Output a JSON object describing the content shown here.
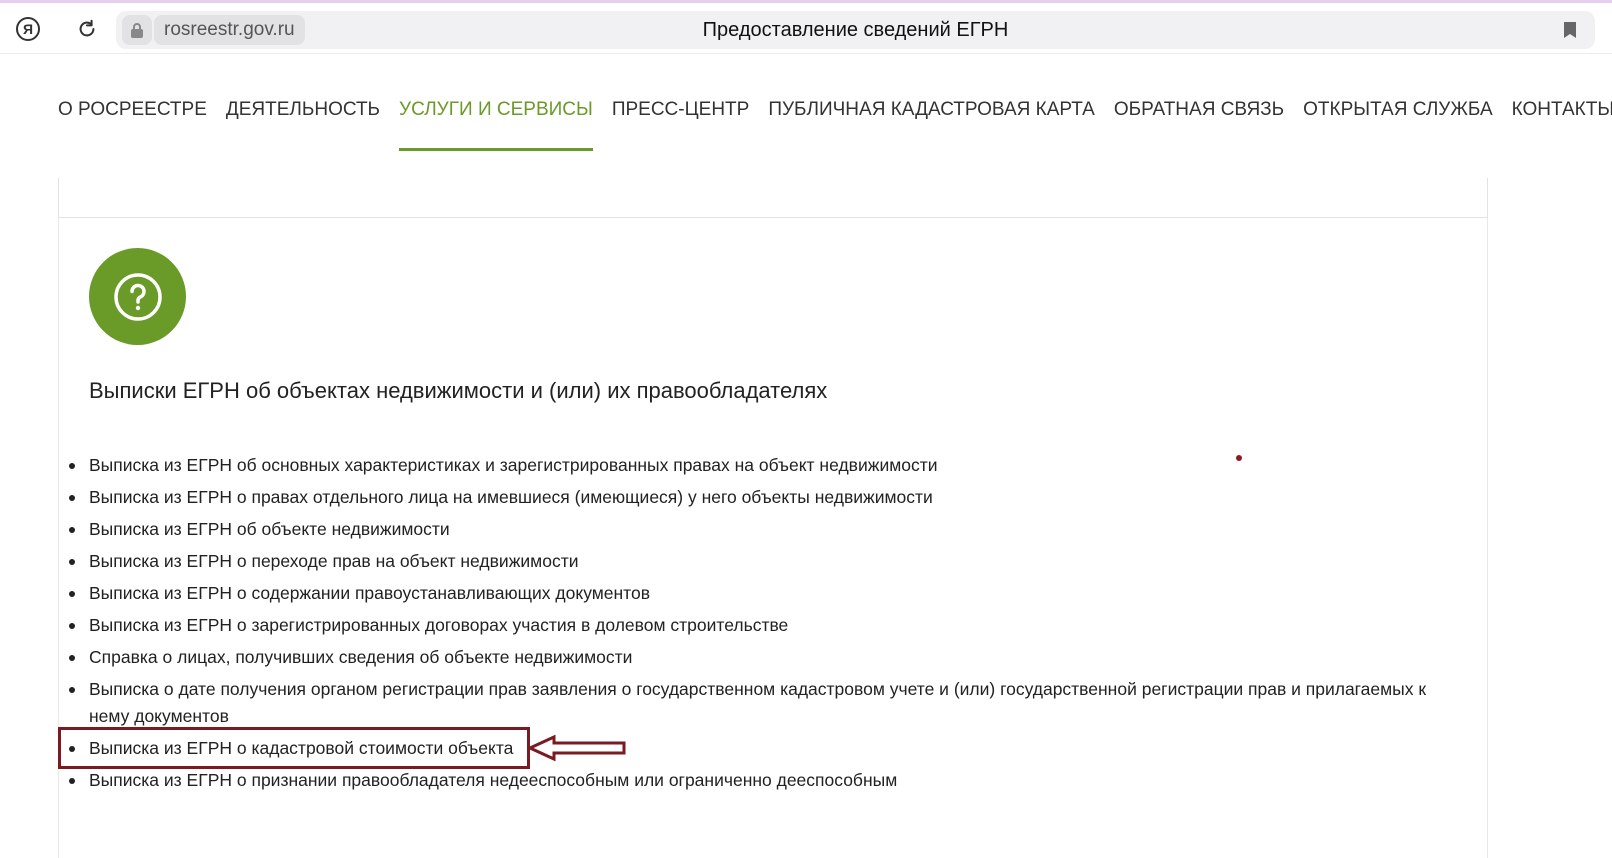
{
  "browser": {
    "domain": "rosreestr.gov.ru",
    "page_title": "Предоставление сведений ЕГРН",
    "yandex_glyph": "Я"
  },
  "nav": {
    "items": [
      {
        "label": "О РОСРЕЕСТРЕ",
        "active": false
      },
      {
        "label": "ДЕЯТЕЛЬНОСТЬ",
        "active": false
      },
      {
        "label": "УСЛУГИ И СЕРВИСЫ",
        "active": true
      },
      {
        "label": "ПРЕСС-ЦЕНТР",
        "active": false
      },
      {
        "label": "ПУБЛИЧНАЯ КАДАСТРОВАЯ КАРТА",
        "active": false
      },
      {
        "label": "ОБРАТНАЯ СВЯЗЬ",
        "active": false
      },
      {
        "label": "ОТКРЫТАЯ СЛУЖБА",
        "active": false
      },
      {
        "label": "КОНТАКТЫ",
        "active": false
      }
    ]
  },
  "section": {
    "icon": "question-circle-icon",
    "heading": "Выписки ЕГРН об объектах недвижимости и (или) их правообладателях",
    "items": [
      "Выписка из ЕГРН об основных характеристиках и зарегистрированных правах на объект недвижимости",
      "Выписка из ЕГРН о правах отдельного лица на имевшиеся (имеющиеся) у него объекты недвижимости",
      "Выписка из ЕГРН об объекте недвижимости",
      "Выписка из ЕГРН о переходе прав на объект недвижимости",
      "Выписка из ЕГРН о содержании правоустанавливающих документов",
      "Выписка из ЕГРН о зарегистрированных договорах участия в долевом строительстве",
      "Справка о лицах, получивших сведения об объекте недвижимости",
      "Выписка о дате получения органом регистрации прав заявления о государственном кадастровом учете и (или) государственной регистрации прав и прилагаемых к нему документов",
      "Выписка из ЕГРН о кадастровой стоимости объекта",
      "Выписка из ЕГРН о признании правообладателя недееспособным или ограниченно дееспособным"
    ]
  },
  "colors": {
    "accent": "#6a9a28",
    "annotation": "#7a1a22"
  }
}
